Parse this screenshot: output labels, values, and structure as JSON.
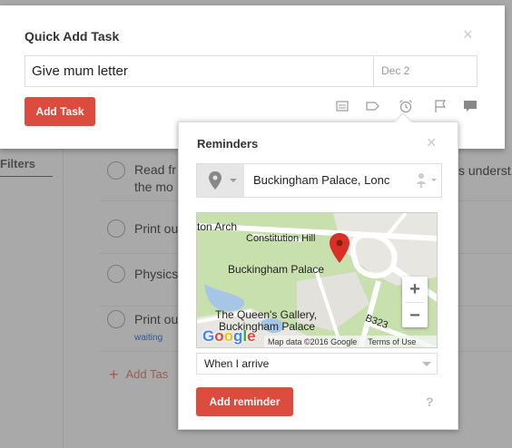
{
  "background": {
    "filters_label": "Filters",
    "tasks": [
      {
        "text": "Read fr",
        "line2": "the mo",
        "tag": ""
      },
      {
        "text": "Print ou",
        "line2": "",
        "tag": ""
      },
      {
        "text": "Physics",
        "line2": "",
        "tag": ""
      },
      {
        "text": "Print ou",
        "line2": "",
        "tag": "waiting"
      }
    ],
    "overflow_text": "s underst",
    "add_task_label": "Add Tas"
  },
  "quick_add": {
    "title": "Quick Add Task",
    "close": "×",
    "task_value": "Give mum letter",
    "date_value": "Dec 2",
    "add_button": "Add Task",
    "toolbar_icons": [
      "project-icon",
      "label-icon",
      "alarm-clock-icon",
      "flag-icon",
      "comment-icon"
    ]
  },
  "reminders": {
    "title": "Reminders",
    "close": "×",
    "location_value": "Buckingham Palace, Lonc",
    "map": {
      "labels": {
        "arch": "ton Arch",
        "hill": "Constitution Hill",
        "palace": "Buckingham Palace",
        "gallery_line1": "The Queen's Gallery,",
        "gallery_line2": "Buckingham Palace",
        "road": "B323"
      },
      "zoom_in": "+",
      "zoom_out": "−",
      "google": [
        "G",
        "o",
        "o",
        "g",
        "l",
        "e"
      ],
      "map_data": "Map data ©2016 Google",
      "terms": "Terms of Use"
    },
    "trigger_value": "When I arrive",
    "add_button": "Add reminder",
    "help": "?"
  },
  "colors": {
    "accent": "#db4c3f",
    "map_green": "#c8dfae",
    "map_road": "#ffffff",
    "map_water": "#a6c6e6",
    "pin": "#d93025"
  }
}
